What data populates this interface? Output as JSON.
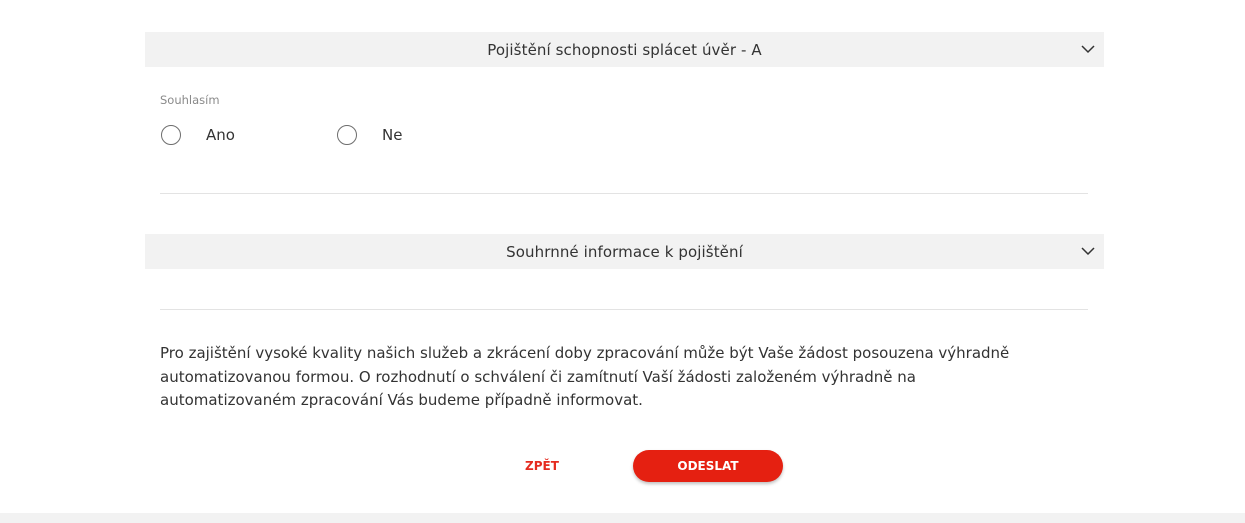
{
  "sections": [
    {
      "title": "Pojištění schopnosti splácet úvěr - A",
      "expanded": true,
      "icon": "chevron-down-icon"
    },
    {
      "title": "Souhrnné informace k pojištění",
      "expanded": false,
      "icon": "chevron-down-icon"
    }
  ],
  "consent": {
    "label": "Souhlasím",
    "options": [
      {
        "label": "Ano",
        "selected": false
      },
      {
        "label": "Ne",
        "selected": false
      }
    ]
  },
  "info_text": "Pro zajištění vysoké kvality našich služeb a zkrácení doby zpracování může být Vaše žádost posouzena výhradně automatizovanou formou. O rozhodnutí o schválení či zamítnutí Vaší žádosti založeném výhradně na automatizovaném zpracování Vás budeme případně informovat.",
  "actions": {
    "back_label": "ZPĚT",
    "submit_label": "ODESLAT"
  },
  "colors": {
    "accent": "#e52011",
    "section_bg": "#f2f2f2",
    "text": "#333333",
    "label": "#8a8a8a"
  }
}
